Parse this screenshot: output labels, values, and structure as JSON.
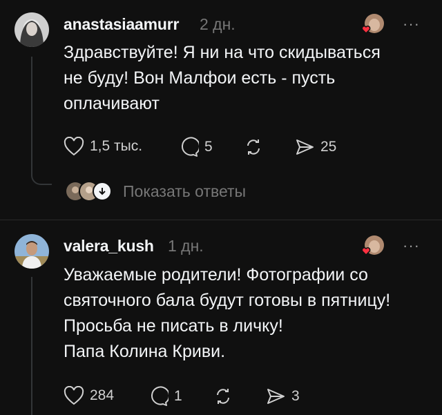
{
  "posts": [
    {
      "username": "anastasiaamurr",
      "time": "2 дн.",
      "text": "Здравствуйте! Я ни на что скидываться\nне буду! Вон Малфои есть - пусть\nоплачивают",
      "likes": "1,5 тыс.",
      "comments": "5",
      "shares": "25",
      "show_replies": "Показать ответы",
      "more": "···"
    },
    {
      "username": "valera_kush",
      "time": "1 дн.",
      "text": "Уважаемые родители! Фотографии со\nсвяточного бала будут готовы в пятницу!\nПросьба не писать в личку!\nПапа Колина Криви.",
      "likes": "284",
      "comments": "1",
      "shares": "3",
      "more": "···"
    }
  ],
  "icons": {
    "like": "heart-outline-icon",
    "comment": "comment-bubble-icon",
    "repost": "repost-icon",
    "share": "send-icon",
    "author_like": "heart-badge-icon"
  },
  "colors": {
    "background": "#101010",
    "text": "#f3f5f7",
    "muted": "#777777",
    "heart_badge": "#ff3040"
  }
}
